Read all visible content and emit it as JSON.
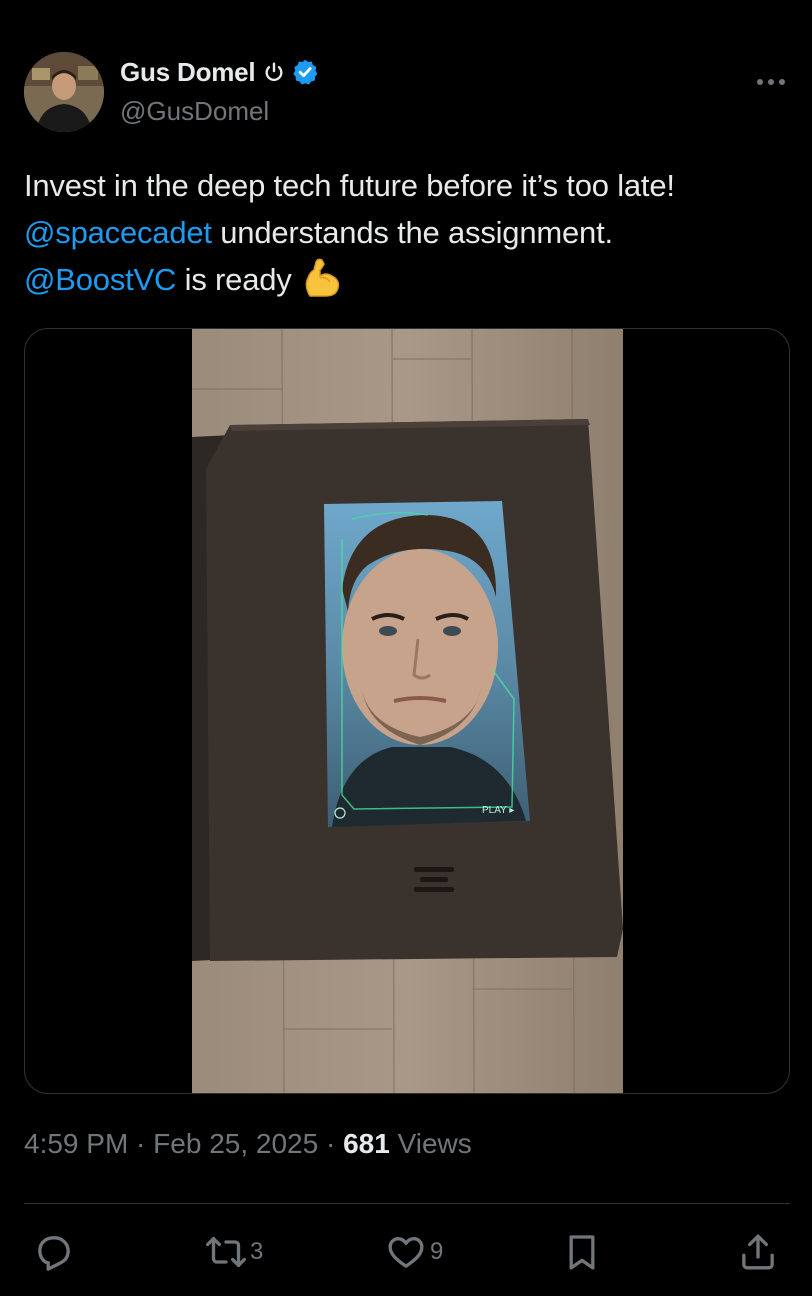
{
  "author": {
    "display_name": "Gus Domel",
    "handle": "@GusDomel",
    "verified": true,
    "icons": [
      "power-icon",
      "verified-badge-icon"
    ]
  },
  "tweet": {
    "line1": "Invest in the deep tech future before it’s too late!",
    "mention1": "@spacecadet",
    "line2_rest": " understands the assignment.",
    "mention2": "@BoostVC",
    "line3_rest": " is ready",
    "emoji": "flexed-biceps-emoji"
  },
  "media": {
    "play_label": "PLAY ▸"
  },
  "meta": {
    "time": "4:59 PM",
    "sep1": " · ",
    "date": "Feb 25, 2025",
    "sep2": " · ",
    "views_count": "681",
    "views_label": " Views"
  },
  "actions": {
    "replies": "",
    "reposts": "3",
    "likes": "9",
    "icons": [
      "reply-icon",
      "repost-icon",
      "like-icon",
      "bookmark-icon",
      "share-icon"
    ]
  },
  "colors": {
    "background": "#000000",
    "text": "#e7e9ea",
    "secondary": "#71767b",
    "link": "#1d9bf0",
    "verified": "#1d9bf0",
    "border": "#2f3336"
  }
}
